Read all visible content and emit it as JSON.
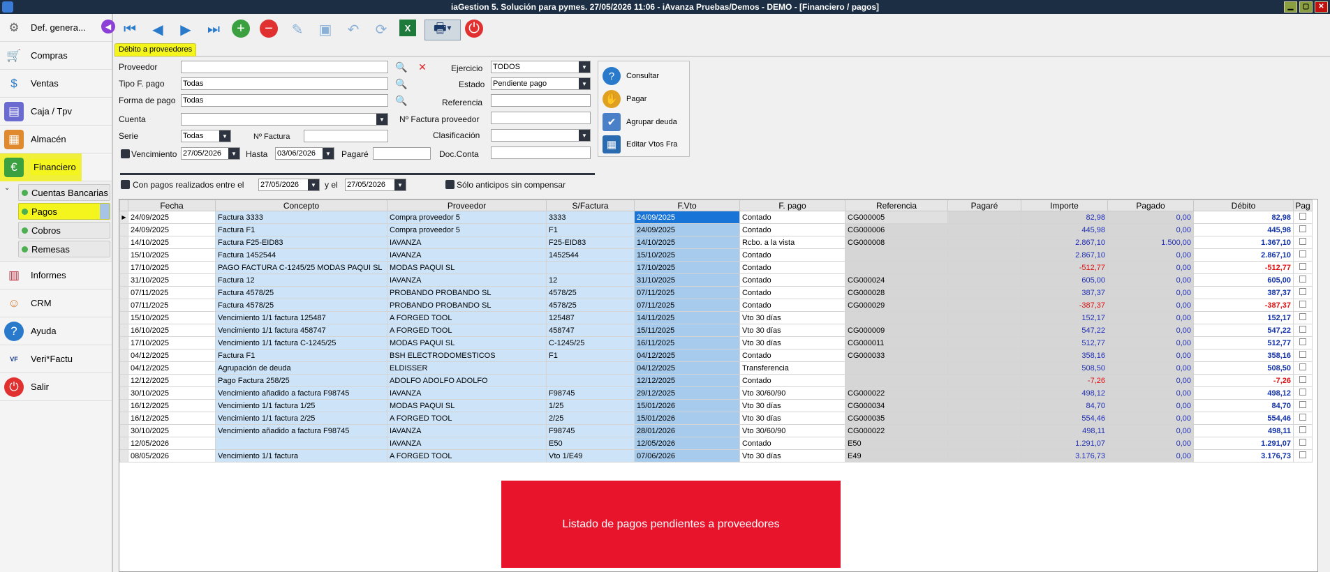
{
  "window": {
    "title": "iaGestion 5. Solución para pymes.   27/05/2026 11:06   -   iAvanza Pruebas/Demos - DEMO - [Financiero / pagos]"
  },
  "sidebar": {
    "items": [
      {
        "label": "Def. genera...",
        "icon": "gear-icon"
      },
      {
        "label": "Compras",
        "icon": "cart-icon"
      },
      {
        "label": "Ventas",
        "icon": "sales-icon"
      },
      {
        "label": "Caja / Tpv",
        "icon": "register-icon"
      },
      {
        "label": "Almacén",
        "icon": "warehouse-icon"
      },
      {
        "label": "Financiero",
        "icon": "finance-icon"
      },
      {
        "label": "Informes",
        "icon": "reports-icon"
      },
      {
        "label": "CRM",
        "icon": "crm-icon"
      },
      {
        "label": "Ayuda",
        "icon": "help-icon"
      },
      {
        "label": "Veri*Factu",
        "icon": "verifactu-icon"
      },
      {
        "label": "Salir",
        "icon": "power-icon"
      }
    ],
    "submenu": [
      "Cuentas Bancarias",
      "Pagos",
      "Cobros",
      "Remesas"
    ]
  },
  "tab": {
    "label": "Débito a proveedores"
  },
  "filters": {
    "proveedor_label": "Proveedor",
    "proveedor_value": "",
    "tipo_label": "Tipo F. pago",
    "tipo_value": "Todas",
    "forma_label": "Forma de pago",
    "forma_value": "Todas",
    "cuenta_label": "Cuenta",
    "cuenta_value": "",
    "serie_label": "Serie",
    "serie_value": "Todas",
    "nfactura_label": "Nº Factura",
    "nfactura_value": "",
    "vencimiento_label": "Vencimiento",
    "vencimiento_value": "27/05/2026",
    "hasta_label": "Hasta",
    "hasta_value": "03/06/2026",
    "pagare_label": "Pagaré",
    "pagare_value": "",
    "ejercicio_label": "Ejercicio",
    "ejercicio_value": "TODOS",
    "estado_label": "Estado",
    "estado_value": "Pendiente pago",
    "referencia_label": "Referencia",
    "referencia_value": "",
    "nfactprov_label": "Nº Factura proveedor",
    "nfactprov_value": "",
    "clasificacion_label": "Clasificación",
    "clasificacion_value": "",
    "docconta_label": "Doc.Conta",
    "docconta_value": "",
    "conpagos_label": "Con pagos realizados entre el",
    "conpagos_from": "27/05/2026",
    "y_el_label": "y el",
    "conpagos_to": "27/05/2026",
    "anticipos_label": "Sólo anticipos sin compensar"
  },
  "actions": {
    "consultar": "Consultar",
    "pagar": "Pagar",
    "agrupar": "Agrupar deuda",
    "editar": "Editar Vtos Fra"
  },
  "grid": {
    "headers": [
      "Fecha",
      "Concepto",
      "Proveedor",
      "S/Factura",
      "F.Vto",
      "F. pago",
      "Referencia",
      "Pagaré",
      "Importe",
      "Pagado",
      "Débito",
      "Pag"
    ],
    "rows": [
      [
        "24/09/2025",
        "Factura 3333",
        "Compra proveedor 5",
        "3333",
        "24/09/2025",
        "Contado",
        "CG000005",
        "",
        "82,98",
        "0,00",
        "82,98"
      ],
      [
        "24/09/2025",
        "Factura F1",
        "Compra proveedor 5",
        "F1",
        "24/09/2025",
        "Contado",
        "CG000006",
        "",
        "445,98",
        "0,00",
        "445,98"
      ],
      [
        "14/10/2025",
        "Factura F25-EID83",
        "IAVANZA",
        "F25-EID83",
        "14/10/2025",
        "Rcbo. a la vista",
        "CG000008",
        "",
        "2.867,10",
        "1.500,00",
        "1.367,10"
      ],
      [
        "15/10/2025",
        "Factura 1452544",
        "IAVANZA",
        "1452544",
        "15/10/2025",
        "Contado",
        "",
        "",
        "2.867,10",
        "0,00",
        "2.867,10"
      ],
      [
        "17/10/2025",
        "PAGO FACTURA C-1245/25 MODAS PAQUI SL",
        "MODAS PAQUI SL",
        "",
        "17/10/2025",
        "Contado",
        "",
        "",
        "-512,77",
        "0,00",
        "-512,77"
      ],
      [
        "31/10/2025",
        "Factura 12",
        "IAVANZA",
        "12",
        "31/10/2025",
        "Contado",
        "CG000024",
        "",
        "605,00",
        "0,00",
        "605,00"
      ],
      [
        "07/11/2025",
        "Factura 4578/25",
        "PROBANDO PROBANDO SL",
        "4578/25",
        "07/11/2025",
        "Contado",
        "CG000028",
        "",
        "387,37",
        "0,00",
        "387,37"
      ],
      [
        "07/11/2025",
        "Factura 4578/25",
        "PROBANDO PROBANDO SL",
        "4578/25",
        "07/11/2025",
        "Contado",
        "CG000029",
        "",
        "-387,37",
        "0,00",
        "-387,37"
      ],
      [
        "15/10/2025",
        "Vencimiento 1/1 factura 125487",
        "A FORGED TOOL",
        "125487",
        "14/11/2025",
        "Vto 30 días",
        "",
        "",
        "152,17",
        "0,00",
        "152,17"
      ],
      [
        "16/10/2025",
        "Vencimiento 1/1 factura          458747",
        "A FORGED TOOL",
        "458747",
        "15/11/2025",
        "Vto 30 días",
        "CG000009",
        "",
        "547,22",
        "0,00",
        "547,22"
      ],
      [
        "17/10/2025",
        "Vencimiento 1/1 factura          C-1245/25",
        "MODAS PAQUI SL",
        "C-1245/25",
        "16/11/2025",
        "Vto 30 días",
        "CG000011",
        "",
        "512,77",
        "0,00",
        "512,77"
      ],
      [
        "04/12/2025",
        "Factura F1",
        "BSH ELECTRODOMESTICOS",
        "F1",
        "04/12/2025",
        "Contado",
        "CG000033",
        "",
        "358,16",
        "0,00",
        "358,16"
      ],
      [
        "04/12/2025",
        "Agrupación de deuda",
        "ELDISSER",
        "",
        "04/12/2025",
        "Transferencia",
        "",
        "",
        "508,50",
        "0,00",
        "508,50"
      ],
      [
        "12/12/2025",
        "Pago Factura 258/25",
        "ADOLFO ADOLFO ADOLFO",
        "",
        "12/12/2025",
        "Contado",
        "",
        "",
        "-7,26",
        "0,00",
        "-7,26"
      ],
      [
        "30/10/2025",
        "Vencimiento añadido a factura F98745",
        "IAVANZA",
        "F98745",
        "29/12/2025",
        "Vto 30/60/90",
        "CG000022",
        "",
        "498,12",
        "0,00",
        "498,12"
      ],
      [
        "16/12/2025",
        "Vencimiento 1/1 factura          1/25",
        "MODAS PAQUI SL",
        "1/25",
        "15/01/2026",
        "Vto 30 días",
        "CG000034",
        "",
        "84,70",
        "0,00",
        "84,70"
      ],
      [
        "16/12/2025",
        "Vencimiento 1/1 factura          2/25",
        "A FORGED TOOL",
        "2/25",
        "15/01/2026",
        "Vto 30 días",
        "CG000035",
        "",
        "554,46",
        "0,00",
        "554,46"
      ],
      [
        "30/10/2025",
        "Vencimiento añadido a factura F98745",
        "IAVANZA",
        "F98745",
        "28/01/2026",
        "Vto 30/60/90",
        "CG000022",
        "",
        "498,11",
        "0,00",
        "498,11"
      ],
      [
        "12/05/2026",
        "",
        "IAVANZA",
        "E50",
        "12/05/2026",
        "Contado",
        "E50",
        "",
        "1.291,07",
        "0,00",
        "1.291,07"
      ],
      [
        "08/05/2026",
        "Vencimiento 1/1 factura",
        "A FORGED TOOL",
        "Vto 1/E49",
        "07/06/2026",
        "Vto 30 días",
        "E49",
        "",
        "3.176,73",
        "0,00",
        "3.176,73"
      ]
    ]
  },
  "banner": {
    "text": "Listado de pagos pendientes a proveedores"
  }
}
